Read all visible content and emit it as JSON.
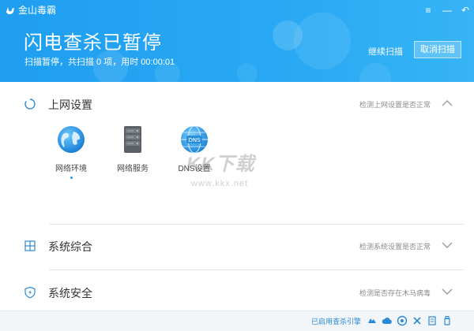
{
  "app": {
    "name": "金山毒霸",
    "minimize": "—",
    "menu": "≡",
    "back": "↶"
  },
  "scan": {
    "title": "闪电查杀已暂停",
    "summary": "扫描暂停，共扫描 0 项，用时 00:00:01",
    "resume_label": "继续扫描",
    "cancel_label": "取消扫描"
  },
  "sections": {
    "network": {
      "title": "上网设置",
      "status": "检测上网设置是否正常",
      "items": [
        {
          "label": "网络环境",
          "icon": "globe-icon"
        },
        {
          "label": "网络服务",
          "icon": "server-icon"
        },
        {
          "label": "DNS设置",
          "icon": "dns-globe-icon"
        }
      ]
    },
    "system": {
      "title": "系统综合",
      "status": "检测系统设置是否正常"
    },
    "security": {
      "title": "系统安全",
      "status": "检测是否存在木马病毒"
    }
  },
  "watermark": {
    "logo_text": "KK下载",
    "url": "www.kkx.net"
  },
  "footer": {
    "engine_text": "已启用查杀引擎",
    "icons": [
      "cloud-engine-icon",
      "cloud-icon",
      "shield-scan-icon",
      "tools-icon",
      "document-icon",
      "usb-icon"
    ]
  },
  "colors": {
    "header_blue": "#1f9ef0",
    "accent": "#1f9ef0"
  }
}
